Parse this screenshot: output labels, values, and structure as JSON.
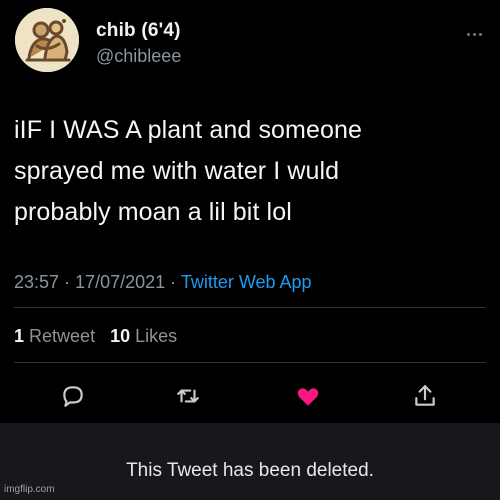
{
  "user": {
    "display_name": "chib (6'4)",
    "handle": "@chibleee",
    "avatar_icon": "hugging-figures-avatar"
  },
  "tweet": {
    "line1": "iIF I WAS A plant and someone",
    "line2": "sprayed me with water I wuld",
    "line3": "probably moan a lil bit lol"
  },
  "meta": {
    "time": "23:57",
    "separator1": " · ",
    "date": "17/07/2021",
    "separator2": " · ",
    "source": "Twitter Web App"
  },
  "stats": {
    "retweets_count": "1",
    "retweets_label": "Retweet",
    "likes_count": "10",
    "likes_label": "Likes"
  },
  "actions": {
    "reply_icon": "reply-icon",
    "retweet_icon": "retweet-icon",
    "like_icon": "heart-icon",
    "share_icon": "share-icon"
  },
  "colors": {
    "background": "#000000",
    "link": "#1d9bf0",
    "like": "#f91880",
    "muted": "#8b959e",
    "deleted_bar": "#16181c"
  },
  "deleted_notice": "This Tweet has been deleted.",
  "watermark": "imgflip.com"
}
